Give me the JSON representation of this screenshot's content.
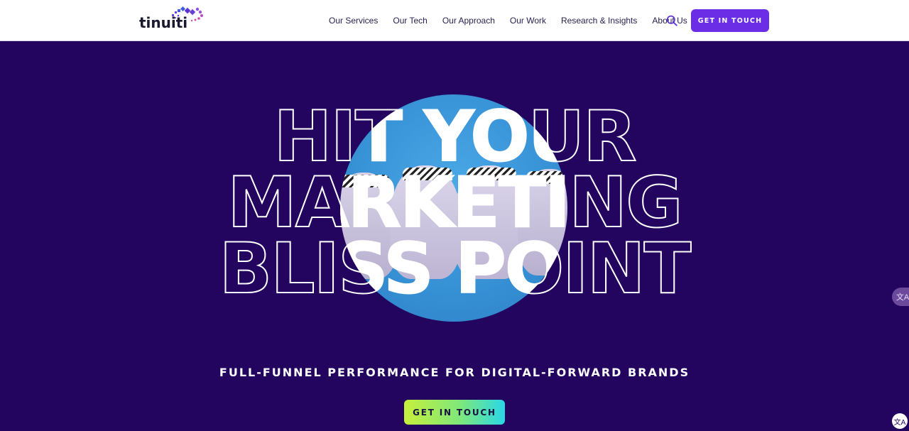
{
  "brand": {
    "name": "tinuiti"
  },
  "nav": {
    "items": [
      {
        "label": "Our Services"
      },
      {
        "label": "Our Tech"
      },
      {
        "label": "Our Approach"
      },
      {
        "label": "Our Work"
      },
      {
        "label": "Research & Insights"
      },
      {
        "label": "About Us"
      }
    ],
    "search_icon": "search-icon",
    "cta_label": "GET IN TOUCH"
  },
  "hero": {
    "headline": {
      "line1": "HIT YOUR",
      "line2": "MARKETING",
      "line3": "BLISS POINT"
    },
    "subheadline": "FULL-FUNNEL PERFORMANCE FOR DIGITAL-FORWARD BRANDS",
    "cta_label": "GET IN TOUCH"
  },
  "widgets": {
    "translate_icon": "translate-icon",
    "translate_glyph": "文A",
    "corner_glyph": "文A"
  },
  "colors": {
    "hero_background": "#23055f",
    "primary_button": "#6b2ee6",
    "hero_cta_gradient": [
      "#c7ef3c",
      "#2ad7e6"
    ],
    "nav_text": "#2a2150"
  }
}
